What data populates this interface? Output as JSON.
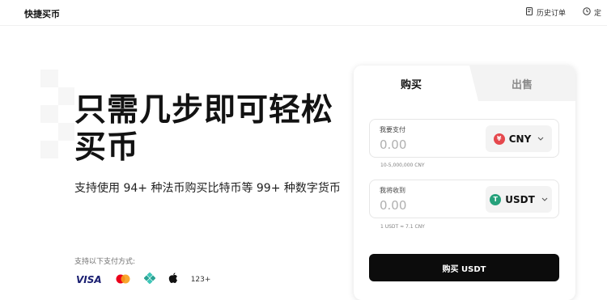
{
  "header": {
    "brand": "快捷买币",
    "orders_label": "历史订单",
    "more_label": "定",
    "icons": [
      "order-history-icon",
      "clock-icon"
    ]
  },
  "hero": {
    "title": "只需几步即可轻松买币",
    "subtitle": "支持使用 94+ 种法币购买比特币等 99+ 种数字货币",
    "payment_label": "支持以下支付方式:",
    "payment_methods": [
      "visa",
      "mastercard",
      "binance",
      "apple"
    ],
    "visa_text": "VISA",
    "more_methods": "123+"
  },
  "trade": {
    "tab_buy": "购买",
    "tab_sell": "出售",
    "pay": {
      "label": "我要支付",
      "value": "0.00",
      "currency": "CNY",
      "currency_symbol": "¥",
      "currency_color": "#e5484d",
      "range": "10-5,000,000 CNY"
    },
    "receive": {
      "label": "我将收到",
      "value": "0.00",
      "currency": "USDT",
      "currency_symbol": "T",
      "currency_color": "#26a17b",
      "rate": "1 USDT ≈ 7.1 CNY"
    },
    "submit_label": "购买 USDT"
  }
}
